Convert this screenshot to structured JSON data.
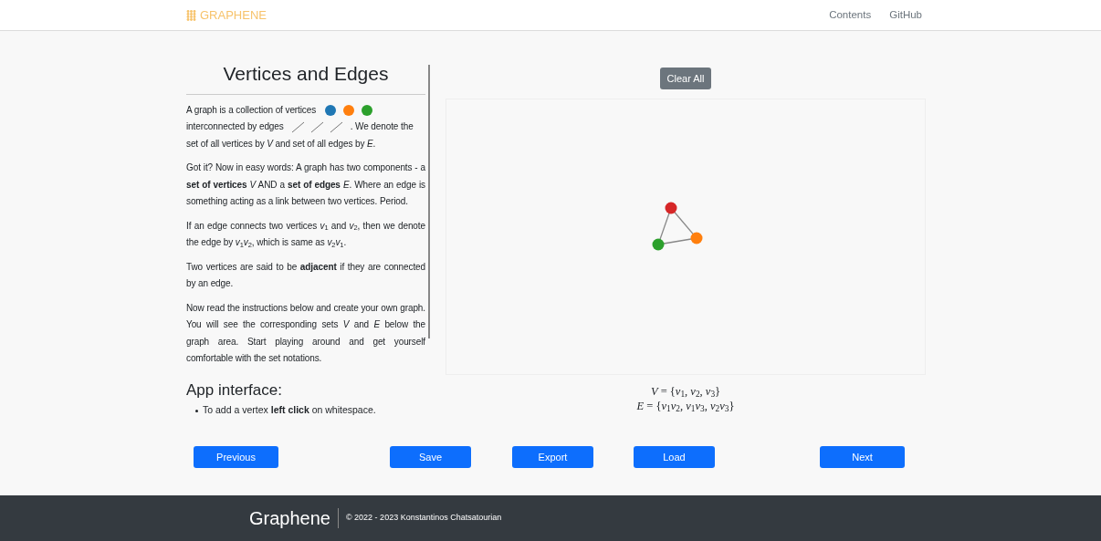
{
  "header": {
    "brand": "GRAPHENE",
    "nav": [
      "Contents",
      "GitHub"
    ]
  },
  "lesson": {
    "title": "Vertices and Edges",
    "intro": {
      "part_1": "A graph is a collection of vertices",
      "vertex_icons": [
        {
          "color": "#1f77b4"
        },
        {
          "color": "#ff7f0e"
        },
        {
          "color": "#2ca02c"
        }
      ],
      "part_2": "interconnected by edges",
      "part_3": ". We denote the",
      "part_4": "set of all vertices by *V* and set of all edges by *E*."
    },
    "paragraphs": [
      "Got it? Now in easy words: A graph has two components - a **set of vertices** *V* AND a **set of edges** *E*. Where an edge is something acting as a link between two vertices. Period.",
      "If an edge connects two vertices *v*$_{1}$ and *v*$_{2}$, then we denote the edge by *v*$_{1}$*v*$_{2}$, which is same as *v*$_{2}$*v*$_{1}$.",
      "Two vertices are said to be **adjacent** if they are connected by an edge.",
      "Now read the instructions below and create your own graph. You will see the corresponding sets *V* and *E* below the graph area. Start playing around and get yourself comfortable with the set notations."
    ]
  },
  "app_interface": {
    "title": "App interface:",
    "bullets": [
      "To add a vertex **left click** on whitespace."
    ]
  },
  "graph": {
    "clear_button": "Clear All",
    "vertices": [
      {
        "color": "#d62728"
      },
      {
        "color": "#ff7f0e"
      },
      {
        "color": "#2ca02c"
      }
    ],
    "vertex_set": "*V* = {*v*$_{1}$, *v*$_{2}$, *v*$_{3}$}",
    "edge_set": "*E* = {*v*$_{1}$*v*$_{2}$, *v*$_{1}$*v*$_{3}$, *v*$_{2}$*v*$_{3}$}"
  },
  "buttons": [
    {
      "label": "Previous"
    },
    {
      "label": "Save"
    },
    {
      "label": "Export"
    },
    {
      "label": "Load"
    },
    {
      "label": "Next"
    }
  ],
  "footer": {
    "brand": "Graphene",
    "copyright": "© 2022 - 2023 Konstantinos Chatsatourian"
  }
}
